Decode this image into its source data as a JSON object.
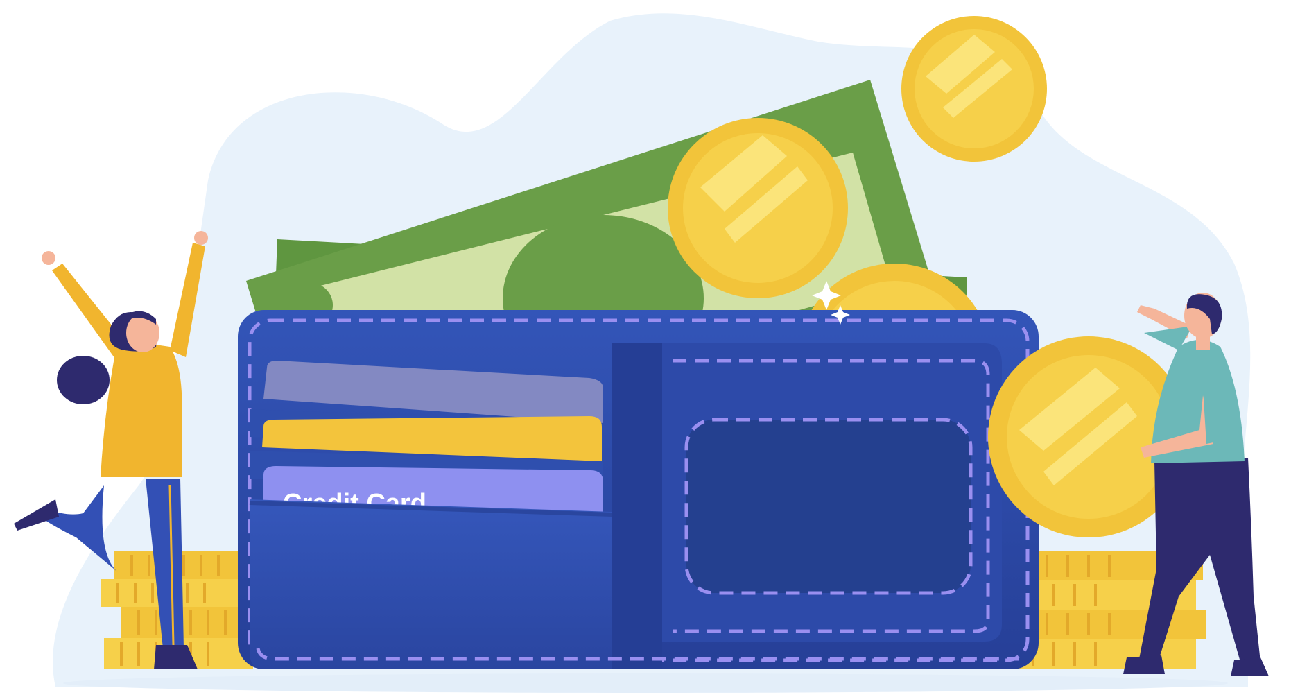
{
  "illustration": {
    "subject": "wallet-with-money",
    "wallet": {
      "cards": [
        {
          "name": "gray-card",
          "color": "#8389c2"
        },
        {
          "name": "yellow-card",
          "color": "#f3c43c"
        },
        {
          "name": "credit-card",
          "color": "#8e90f0",
          "label": "Credit Card"
        }
      ]
    },
    "colors": {
      "background_blob": "#e8f2fb",
      "wallet_blue": "#2f4fae",
      "wallet_dark": "#243f97",
      "stitch": "#9a8ff0",
      "bill_dark": "#6a9e48",
      "bill_light": "#d2e2a6",
      "coin_gold": "#f2c43a",
      "coin_light": "#f6dc4c",
      "person_yellow": "#f1b52e",
      "person_navy": "#2e2a6e",
      "jeans_blue": "#3350b5",
      "shirt_teal": "#6cb8b8",
      "skin": "#f5b59a"
    }
  }
}
